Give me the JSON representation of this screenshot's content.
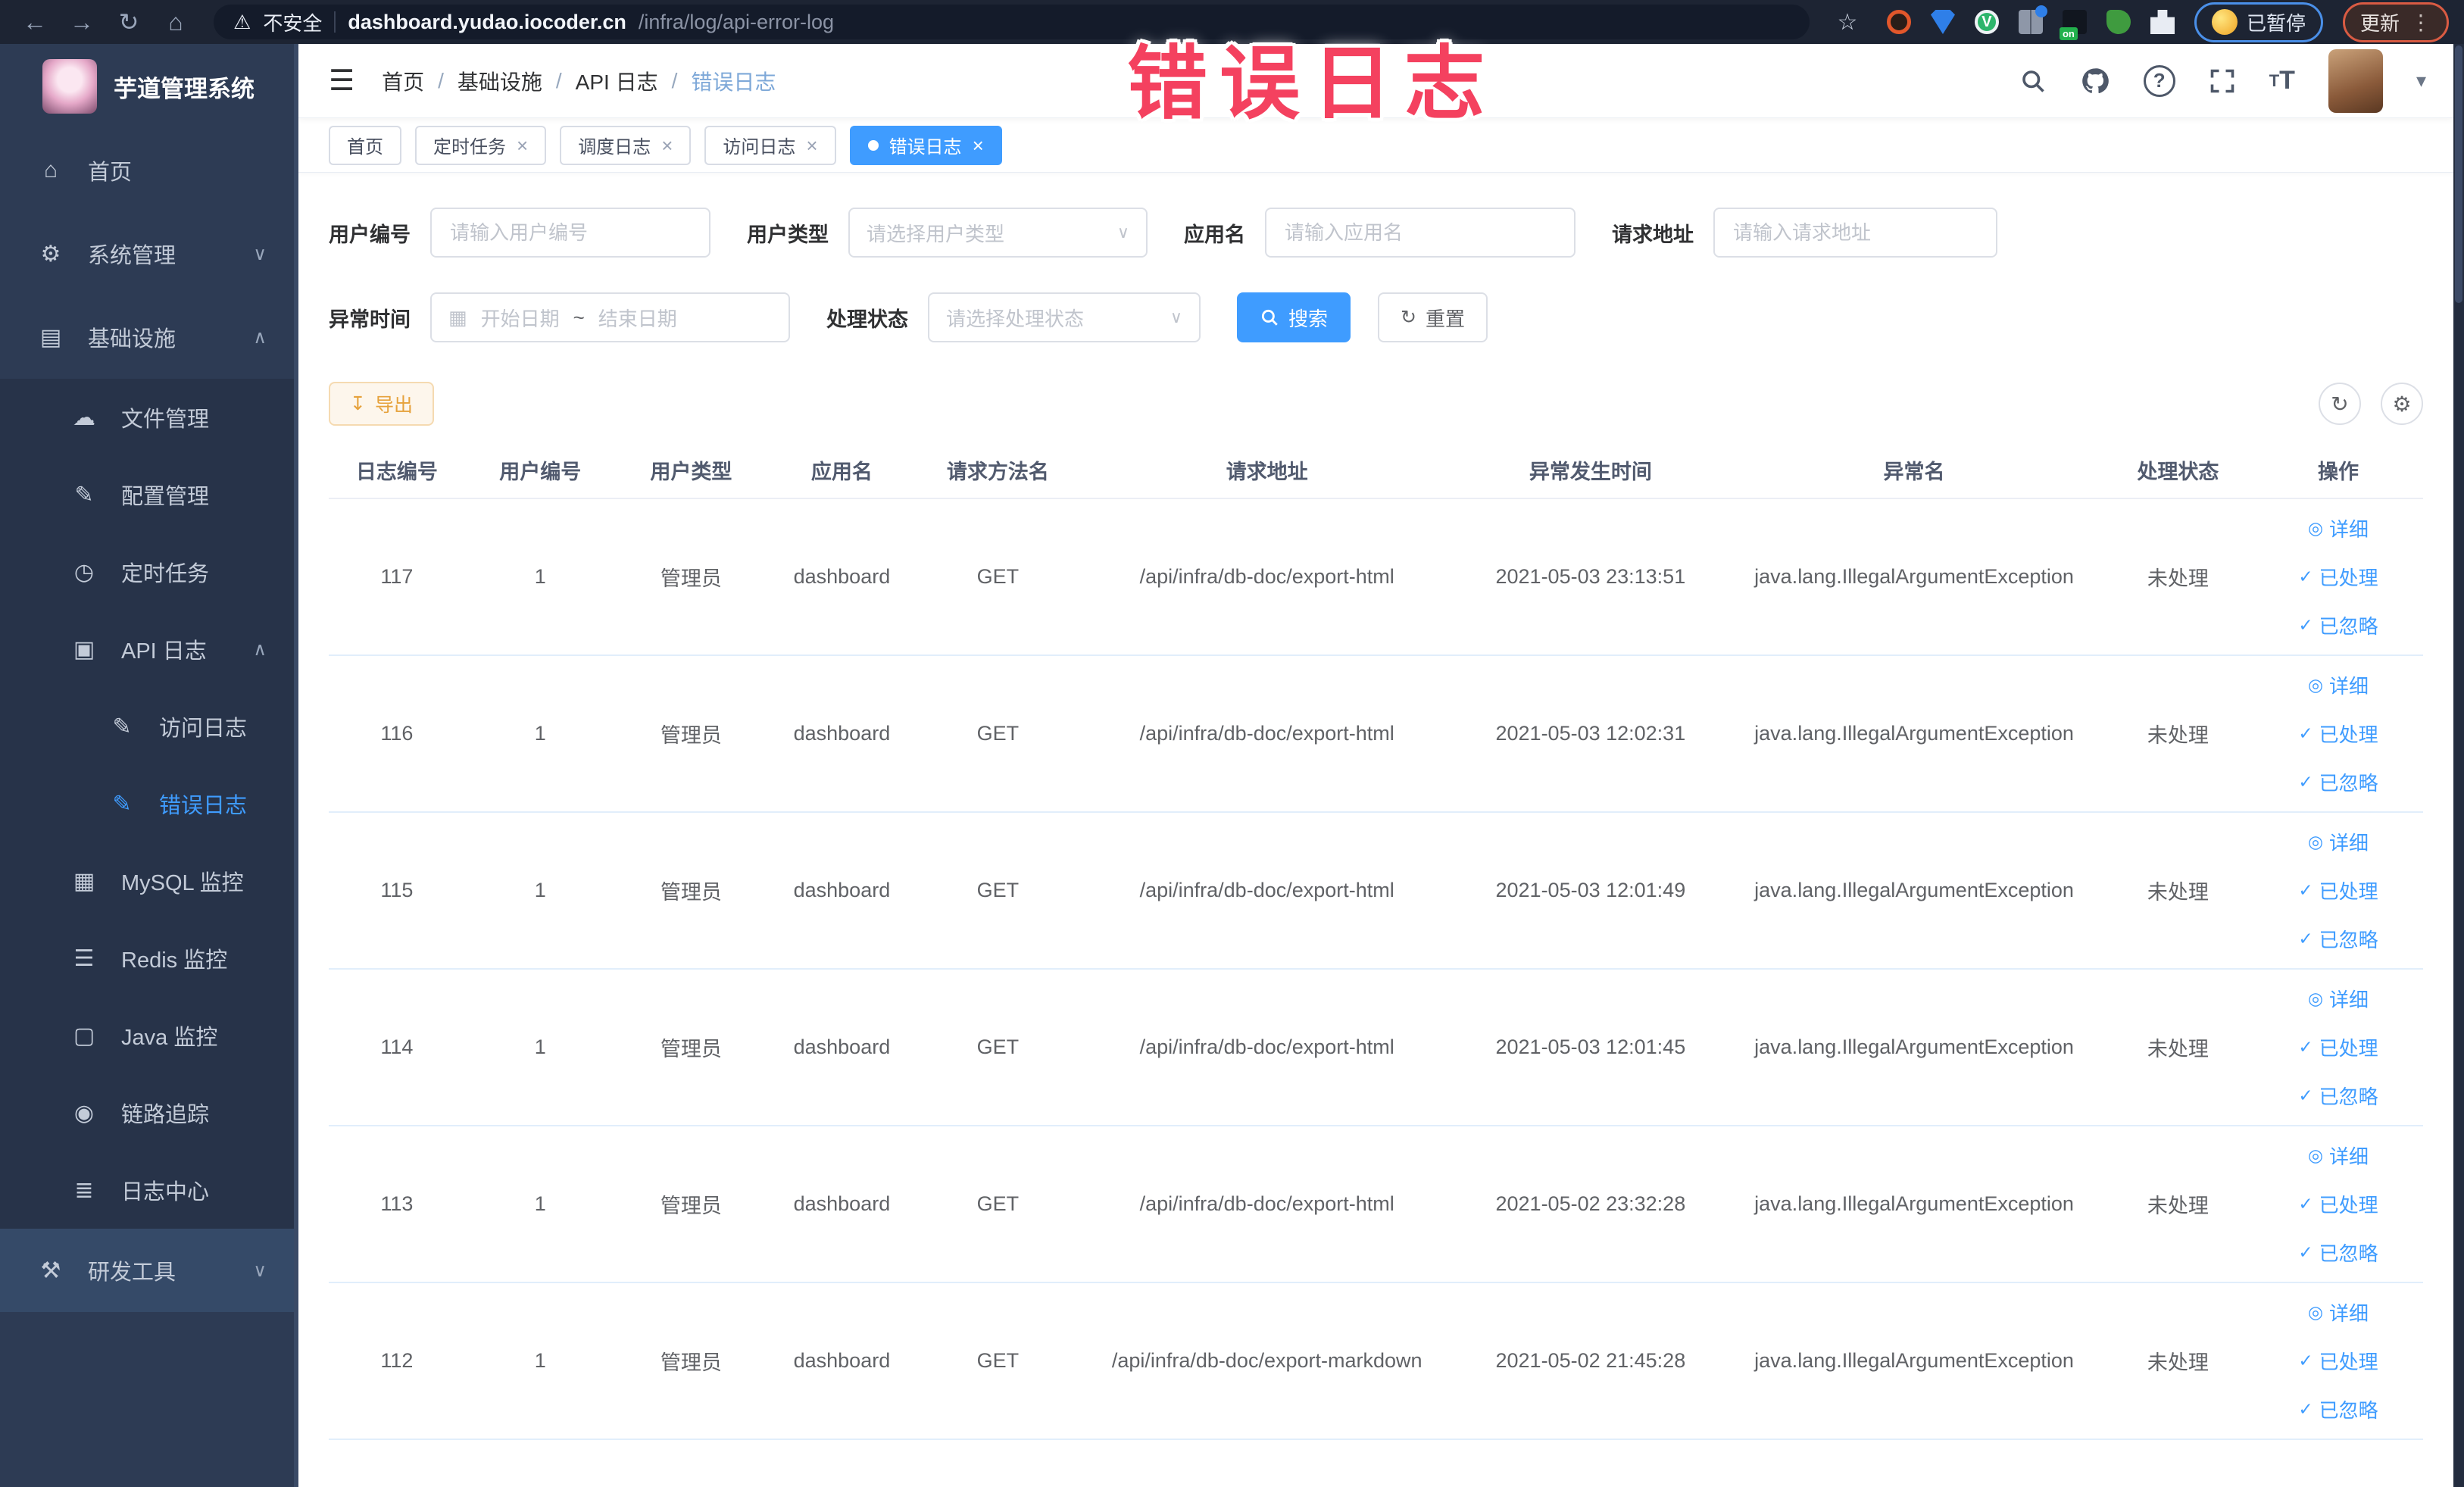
{
  "browser": {
    "security_label": "不安全",
    "url_host": "dashboard.yudao.iocoder.cn",
    "url_path": "/infra/log/api-error-log",
    "paused_badge": "已暂停",
    "update_button": "更新"
  },
  "annotation": {
    "title": "错误日志"
  },
  "sidebar": {
    "logo_title": "芋道管理系统",
    "items": [
      {
        "label": "首页",
        "icon": "home-icon",
        "level": 1
      },
      {
        "label": "系统管理",
        "icon": "gear-icon",
        "level": 1,
        "chevron": "down"
      },
      {
        "label": "基础设施",
        "icon": "infrastructure-icon",
        "level": 1,
        "chevron": "up"
      },
      {
        "label": "文件管理",
        "icon": "file-icon",
        "level": 2,
        "sub": true
      },
      {
        "label": "配置管理",
        "icon": "config-icon",
        "level": 2,
        "sub": true
      },
      {
        "label": "定时任务",
        "icon": "cron-icon",
        "level": 2,
        "sub": true
      },
      {
        "label": "API 日志",
        "icon": "api-log-icon",
        "level": 2,
        "sub": true,
        "chevron": "up"
      },
      {
        "label": "访问日志",
        "icon": "access-log-icon",
        "level": 3,
        "sub": true
      },
      {
        "label": "错误日志",
        "icon": "error-log-icon",
        "level": 3,
        "sub": true,
        "active": true
      },
      {
        "label": "MySQL 监控",
        "icon": "mysql-icon",
        "level": 2,
        "sub": true
      },
      {
        "label": "Redis 监控",
        "icon": "redis-icon",
        "level": 2,
        "sub": true
      },
      {
        "label": "Java 监控",
        "icon": "java-icon",
        "level": 2,
        "sub": true
      },
      {
        "label": "链路追踪",
        "icon": "trace-icon",
        "level": 2,
        "sub": true
      },
      {
        "label": "日志中心",
        "icon": "log-center-icon",
        "level": 2,
        "sub": true
      },
      {
        "label": "研发工具",
        "icon": "devtools-icon",
        "level": 1,
        "chevron": "down",
        "highlighted": true
      }
    ]
  },
  "header": {
    "breadcrumb": [
      "首页",
      "基础设施",
      "API 日志",
      "错误日志"
    ]
  },
  "tabs": {
    "items": [
      {
        "label": "首页"
      },
      {
        "label": "定时任务",
        "closable": true
      },
      {
        "label": "调度日志",
        "closable": true
      },
      {
        "label": "访问日志",
        "closable": true
      },
      {
        "label": "错误日志",
        "closable": true,
        "active": true
      }
    ]
  },
  "filters": {
    "user_id": {
      "label": "用户编号",
      "placeholder": "请输入用户编号"
    },
    "user_type": {
      "label": "用户类型",
      "placeholder": "请选择用户类型"
    },
    "app_name": {
      "label": "应用名",
      "placeholder": "请输入应用名"
    },
    "request_url": {
      "label": "请求地址",
      "placeholder": "请输入请求地址"
    },
    "exception_time": {
      "label": "异常时间",
      "start_placeholder": "开始日期",
      "separator": "~",
      "end_placeholder": "结束日期"
    },
    "process_status": {
      "label": "处理状态",
      "placeholder": "请选择处理状态"
    },
    "search_button": "搜索",
    "reset_button": "重置"
  },
  "toolbar": {
    "export_button": "导出"
  },
  "table": {
    "columns": [
      "日志编号",
      "用户编号",
      "用户类型",
      "应用名",
      "请求方法名",
      "请求地址",
      "异常发生时间",
      "异常名",
      "处理状态",
      "操作"
    ],
    "row_actions": [
      {
        "icon": "eye-icon",
        "label": "详细"
      },
      {
        "icon": "check-icon",
        "label": "已处理"
      },
      {
        "icon": "check-icon",
        "label": "已忽略"
      }
    ],
    "rows": [
      {
        "log_id": "117",
        "user_id": "1",
        "user_type": "管理员",
        "app_name": "dashboard",
        "method": "GET",
        "url": "/api/infra/db-doc/export-html",
        "time": "2021-05-03 23:13:51",
        "exception": "java.lang.IllegalArgumentException",
        "status": "未处理"
      },
      {
        "log_id": "116",
        "user_id": "1",
        "user_type": "管理员",
        "app_name": "dashboard",
        "method": "GET",
        "url": "/api/infra/db-doc/export-html",
        "time": "2021-05-03 12:02:31",
        "exception": "java.lang.IllegalArgumentException",
        "status": "未处理"
      },
      {
        "log_id": "115",
        "user_id": "1",
        "user_type": "管理员",
        "app_name": "dashboard",
        "method": "GET",
        "url": "/api/infra/db-doc/export-html",
        "time": "2021-05-03 12:01:49",
        "exception": "java.lang.IllegalArgumentException",
        "status": "未处理"
      },
      {
        "log_id": "114",
        "user_id": "1",
        "user_type": "管理员",
        "app_name": "dashboard",
        "method": "GET",
        "url": "/api/infra/db-doc/export-html",
        "time": "2021-05-03 12:01:45",
        "exception": "java.lang.IllegalArgumentException",
        "status": "未处理"
      },
      {
        "log_id": "113",
        "user_id": "1",
        "user_type": "管理员",
        "app_name": "dashboard",
        "method": "GET",
        "url": "/api/infra/db-doc/export-html",
        "time": "2021-05-02 23:32:28",
        "exception": "java.lang.IllegalArgumentException",
        "status": "未处理"
      },
      {
        "log_id": "112",
        "user_id": "1",
        "user_type": "管理员",
        "app_name": "dashboard",
        "method": "GET",
        "url": "/api/infra/db-doc/export-markdown",
        "time": "2021-05-02 21:45:28",
        "exception": "java.lang.IllegalArgumentException",
        "status": "未处理"
      }
    ]
  },
  "colors": {
    "accent": "#409eff",
    "warning": "#e6a23c",
    "annotation_pink": "#f4415f",
    "sidebar_bg": "#2d3b54"
  }
}
